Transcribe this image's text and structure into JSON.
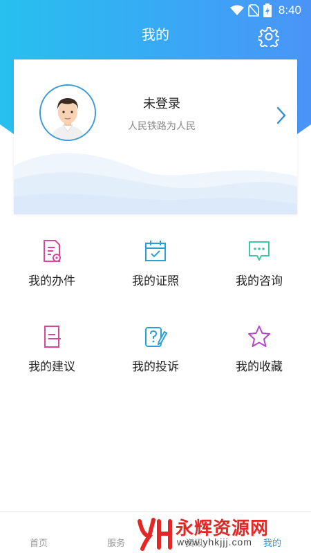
{
  "status_bar": {
    "time": "8:40"
  },
  "header": {
    "title": "我的"
  },
  "profile": {
    "name": "未登录",
    "subtitle": "人民铁路为人民"
  },
  "menu": [
    {
      "label": "我的办件",
      "icon": "document-icon",
      "color": "#d9459b"
    },
    {
      "label": "我的证照",
      "icon": "calendar-icon",
      "color": "#2aa0d8"
    },
    {
      "label": "我的咨询",
      "icon": "chat-icon",
      "color": "#3fc7a3"
    },
    {
      "label": "我的建议",
      "icon": "suggestion-icon",
      "color": "#d9459b"
    },
    {
      "label": "我的投诉",
      "icon": "complaint-icon",
      "color": "#2aa0d8"
    },
    {
      "label": "我的收藏",
      "icon": "star-icon",
      "color": "#b246c9"
    }
  ],
  "bottom_nav": {
    "tabs": [
      {
        "label": "首页"
      },
      {
        "label": "服务"
      },
      {
        "label": "资讯"
      },
      {
        "label": "我的",
        "active": true
      }
    ]
  },
  "watermark": {
    "text": "永辉资源网",
    "url": "www.yhkjjj.com"
  },
  "colors": {
    "accent": "#2b9de8",
    "header_start": "#27c0ee",
    "header_end": "#4a94f7"
  }
}
